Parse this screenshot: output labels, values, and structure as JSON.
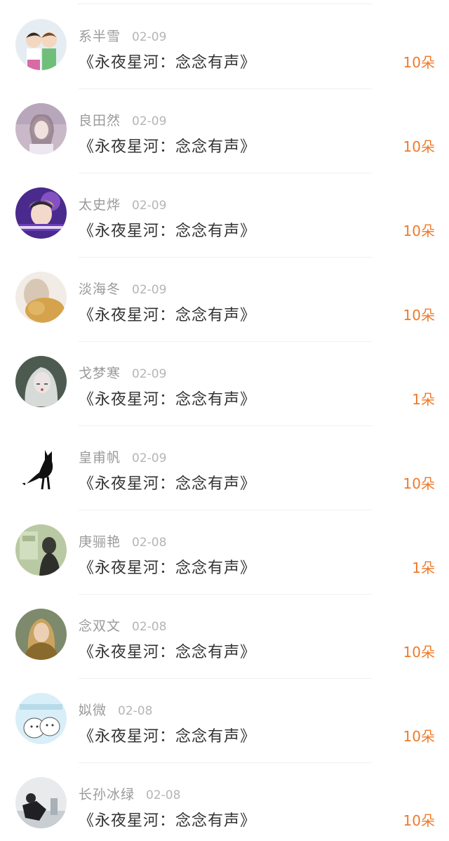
{
  "colors": {
    "accent": "#ee7a2b",
    "name": "#9a9a9a",
    "date": "#b5b5b5",
    "title": "#333333"
  },
  "items": [
    {
      "name": "系半雪",
      "date": "02-09",
      "gift": "《永夜星河：念念有声》",
      "amount": "10朵",
      "avatar_icon": "cartoon-boys-avatar"
    },
    {
      "name": "良田然",
      "date": "02-09",
      "gift": "《永夜星河：念念有声》",
      "amount": "10朵",
      "avatar_icon": "girl-portrait-avatar"
    },
    {
      "name": "太史烨",
      "date": "02-09",
      "gift": "《永夜星河：念念有声》",
      "amount": "10朵",
      "avatar_icon": "boy-purple-avatar"
    },
    {
      "name": "淡海冬",
      "date": "02-09",
      "gift": "《永夜星河：念念有声》",
      "amount": "10朵",
      "avatar_icon": "teddy-bear-avatar"
    },
    {
      "name": "戈梦寒",
      "date": "02-09",
      "gift": "《永夜星河：念念有声》",
      "amount": "1朵",
      "avatar_icon": "silver-hair-girl-avatar"
    },
    {
      "name": "皇甫帆",
      "date": "02-09",
      "gift": "《永夜星河：念念有声》",
      "amount": "10朵",
      "avatar_icon": "black-cat-avatar"
    },
    {
      "name": "庚骊艳",
      "date": "02-08",
      "gift": "《永夜星河：念念有声》",
      "amount": "1朵",
      "avatar_icon": "girl-window-avatar"
    },
    {
      "name": "念双文",
      "date": "02-08",
      "gift": "《永夜星河：念念有声》",
      "amount": "10朵",
      "avatar_icon": "blonde-woman-avatar"
    },
    {
      "name": "姒微",
      "date": "02-08",
      "gift": "《永夜星河：念念有声》",
      "amount": "10朵",
      "avatar_icon": "cartoon-bears-avatar"
    },
    {
      "name": "长孙冰绿",
      "date": "02-08",
      "gift": "《永夜星河：念念有声》",
      "amount": "10朵",
      "avatar_icon": "sitting-person-avatar"
    }
  ]
}
